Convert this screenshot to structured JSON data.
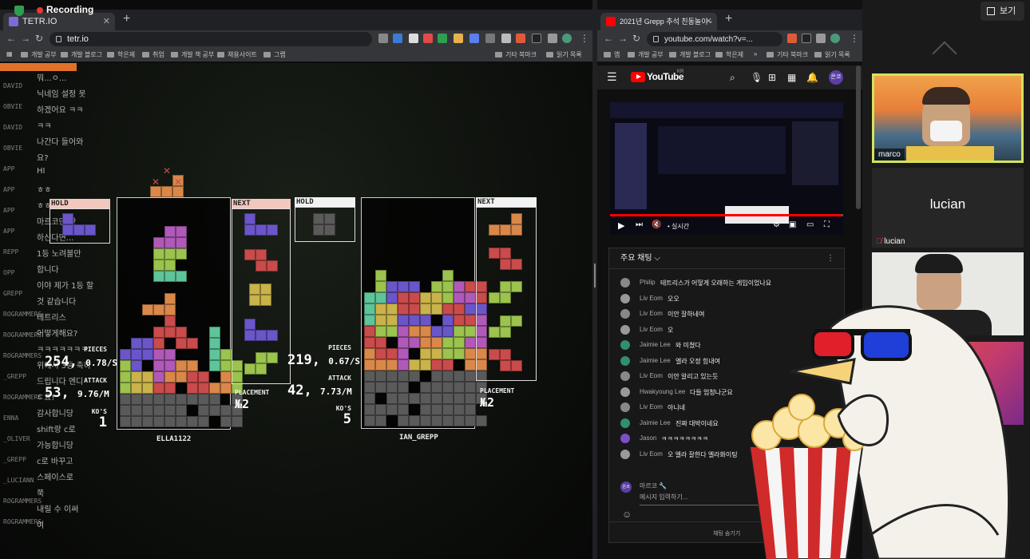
{
  "recording": {
    "label": "Recording"
  },
  "left_browser": {
    "tab_title": "TETR.IO",
    "url": "tetr.io",
    "bookmarks": [
      "개발 공부",
      "개발 블로그",
      "학은제",
      "취업",
      "개발 책 공부",
      "채용사이트",
      "그랩"
    ],
    "bookmarks_right": [
      "기타 북마크",
      "읽기 목록"
    ]
  },
  "game": {
    "chat_log_names": [
      "DAVID",
      "OBVIE",
      "DAVID",
      "OBVIE",
      "APP",
      "APP",
      "APP",
      "APP",
      "REPP",
      "OPP",
      "GREPP",
      "ROGRAMMERS",
      "ROGRAMMERS",
      "ROGRAMMERS",
      "_GREPP",
      "ROGRAMMERS",
      "ENNA",
      "_OLIVER",
      "_GREPP",
      "_LUCIANN",
      "ROGRAMMERS",
      "ROGRAMMERS"
    ],
    "chat_log_messages": [
      {
        "text": "뭐...ㅇ..."
      },
      {
        "text": "닉네임 설정 못"
      },
      {
        "text": "하겠어요 ㅋㅋ"
      },
      {
        "text": "ㅋㅋ"
      },
      {
        "text": "나간다 들어와"
      },
      {
        "text": "요?"
      },
      {
        "text": "HI"
      },
      {
        "text": "ㅎㅎ"
      },
      {
        "text": "ㅎㅎㅎ"
      },
      {
        "text": "마르코만 안"
      },
      {
        "text": "하신다면..."
      },
      {
        "text": "1등 노려볼만"
      },
      {
        "text": "합니다"
      },
      {
        "text": "이야 제가 1등 할"
      },
      {
        "text": "것 같습니다"
      },
      {
        "text": "테트리스"
      },
      {
        "text": "어떻게해요?"
      },
      {
        "text": "ㅋㅋㅋㅋㅋㅋㅋ"
      },
      {
        "text": "위에서 3등 축하"
      },
      {
        "text": "드립니다 엔디"
      },
      {
        "text": "ㄷ요!"
      },
      {
        "text": "감사합니당"
      },
      {
        "text": "shift랑 c로"
      },
      {
        "text": "가능합니당"
      },
      {
        "text": "c로 바꾸고"
      },
      {
        "text": "스페이스로"
      },
      {
        "text": "쭉"
      },
      {
        "text": "내릴 수 이써"
      },
      {
        "text": "여"
      }
    ],
    "players": [
      {
        "name": "ELLA1122",
        "hold_label": "HOLD",
        "next_label": "NEXT",
        "pieces_label": "PIECES",
        "pieces_value": "254",
        "pieces_rate": "0.78/S",
        "attack_label": "ATTACK",
        "attack_value": "53",
        "attack_rate": "9.76/M",
        "kos_label": "KO'S",
        "kos_value": "1",
        "placement_label": "PLACEMENT",
        "placement_value": "№2"
      },
      {
        "name": "IAN_GREPP",
        "hold_label": "HOLD",
        "next_label": "NEXT",
        "pieces_label": "PIECES",
        "pieces_value": "219",
        "pieces_rate": "0.67/S",
        "attack_label": "ATTACK",
        "attack_value": "42",
        "attack_rate": "7.73/M",
        "kos_label": "KO'S",
        "kos_value": "5",
        "placement_label": "PLACEMENT",
        "placement_value": "№2"
      }
    ],
    "colors": {
      "Z": "#c94b4b",
      "S": "#9bc34d",
      "L": "#d9884a",
      "J": "#6a56c8",
      "T": "#b059b8",
      "O": "#c9b34a",
      "I": "#5ec49a",
      "G": "#5a5a5a"
    }
  },
  "right_browser": {
    "tab_title": "2021년 Grepp 추석 친동놀이 - You",
    "url": "youtube.com/watch?v=...",
    "bookmarks": [
      "앱",
      "개발 공부",
      "개발 블로그",
      "학은제"
    ],
    "bookmarks_right": [
      "기타 북마크",
      "읽기 목록"
    ],
    "yt_logo": "YouTube",
    "yt_region": "KR",
    "user_avatar": "은코",
    "video_live": "• 실시간",
    "chat_title": "주요 채팅 ⌵",
    "chat_messages": [
      {
        "name": "Philip",
        "text": "테트리스가 어떻게 오래하는 게임이었나요"
      },
      {
        "name": "Liv Eom",
        "text": "오오"
      },
      {
        "name": "Liv Eom",
        "text": "이안 잘하네여"
      },
      {
        "name": "Liv Eom",
        "text": "오"
      },
      {
        "name": "Jaimie Lee",
        "text": "와 미쳤다"
      },
      {
        "name": "Jaimie Lee",
        "text": "엘라 오정 힘내여"
      },
      {
        "name": "Liv Eom",
        "text": "이안 알리고 있는듯"
      },
      {
        "name": "Hwakyoung Lee",
        "text": "다들 엄청나군요"
      },
      {
        "name": "Liv Eom",
        "text": "아니네"
      },
      {
        "name": "Jaimie Lee",
        "text": "진짜 대박이네요"
      },
      {
        "name": "Jason",
        "text": "ㅋㅋㅋㅋㅋㅋㅋㅋ"
      },
      {
        "name": "Liv Eom",
        "text": "오 엘라 잘한다 엘라화이팅"
      }
    ],
    "composer_name": "마르코 🔧",
    "composer_placeholder": "메시지 입력하기...",
    "hide_chat": "채팅 숨기기"
  },
  "zoom": {
    "view_button": "보기",
    "participants": [
      {
        "name": "marco"
      },
      {
        "name": "lucian"
      },
      {
        "name": "lucian",
        "muted": true
      }
    ]
  }
}
